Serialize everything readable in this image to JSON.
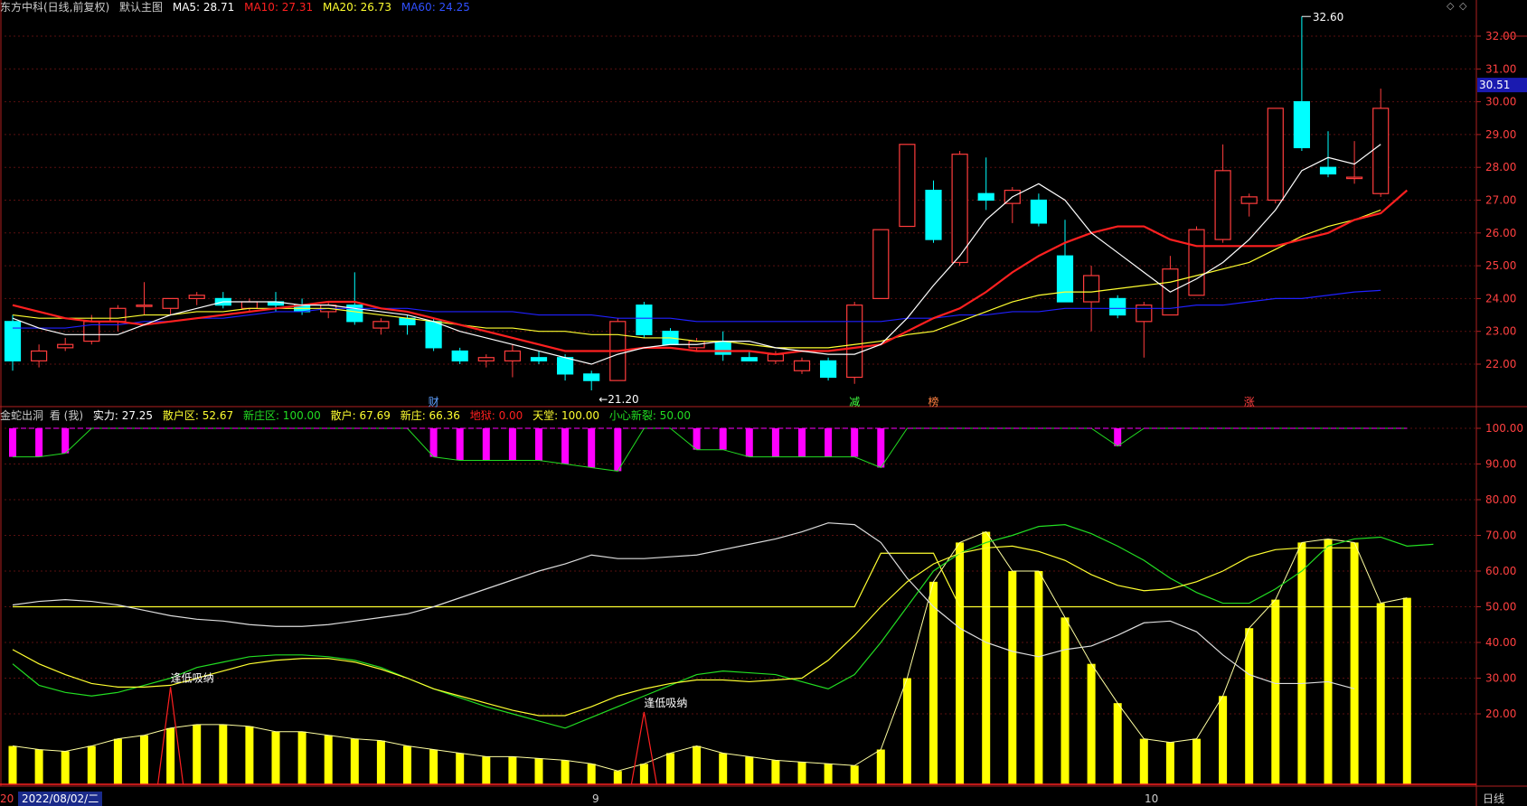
{
  "main_header": {
    "title": "东方中科(日线,前复权)",
    "template": "默认主图",
    "ma5": "MA5: 28.71",
    "ma10": "MA10: 27.31",
    "ma20": "MA20: 26.73",
    "ma60": "MA60: 24.25"
  },
  "ind_header": {
    "name": "金蛇出洞",
    "view": "看 (我)",
    "strength": "实力: 27.25",
    "retail_zone": "散户区: 52.67",
    "new_dealer_zone": "新庄区: 100.00",
    "retail": "散户: 67.69",
    "new_dealer": "新庄: 66.36",
    "ground": "地狱: 0.00",
    "heaven": "天堂: 100.00",
    "careful": "小心新裂: 50.00"
  },
  "price_marker": "30.51",
  "high_label": "32.60",
  "low_label": "←21.20",
  "signal_label": "逢低吸纳",
  "event_labels": [
    "财",
    "减",
    "榜",
    "涨"
  ],
  "bottom_bar": {
    "date": "2022/08/02/二",
    "month1": "9",
    "month2": "10",
    "period": "日线",
    "prefix": "20"
  },
  "colors": {
    "up": "#ff3c3c",
    "down": "#00ffff",
    "ma5": "#ffffff",
    "ma10": "#ff2020",
    "ma20": "#ffff30",
    "ma60": "#2020ff",
    "bar": "#ffff00",
    "magenta": "#ff00ff",
    "green": "#22dd22"
  },
  "chart_data": [
    {
      "type": "candlestick",
      "ylim": [
        21.0,
        33.0
      ],
      "yticks": [
        "22.00",
        "23.00",
        "24.00",
        "25.00",
        "26.00",
        "27.00",
        "28.00",
        "29.00",
        "30.00",
        "31.00",
        "32.00"
      ],
      "ohlc": [
        [
          23.3,
          23.5,
          21.8,
          22.1
        ],
        [
          22.1,
          22.6,
          21.9,
          22.4
        ],
        [
          22.5,
          22.8,
          22.4,
          22.6
        ],
        [
          22.7,
          23.5,
          22.6,
          23.3
        ],
        [
          23.3,
          23.8,
          23.0,
          23.7
        ],
        [
          23.8,
          24.5,
          23.5,
          23.8
        ],
        [
          23.7,
          24.0,
          23.5,
          24.0
        ],
        [
          24.0,
          24.2,
          23.8,
          24.1
        ],
        [
          24.0,
          24.2,
          23.7,
          23.8
        ],
        [
          23.7,
          24.0,
          23.6,
          23.9
        ],
        [
          23.9,
          24.2,
          23.6,
          23.8
        ],
        [
          23.8,
          24.0,
          23.5,
          23.6
        ],
        [
          23.6,
          23.9,
          23.4,
          23.8
        ],
        [
          23.8,
          24.8,
          23.2,
          23.3
        ],
        [
          23.1,
          23.4,
          22.9,
          23.3
        ],
        [
          23.4,
          23.5,
          22.9,
          23.2
        ],
        [
          23.3,
          23.4,
          22.4,
          22.5
        ],
        [
          22.4,
          22.5,
          22.0,
          22.1
        ],
        [
          22.1,
          22.3,
          21.9,
          22.2
        ],
        [
          22.1,
          22.6,
          21.6,
          22.4
        ],
        [
          22.2,
          22.4,
          22.0,
          22.1
        ],
        [
          22.2,
          22.3,
          21.5,
          21.7
        ],
        [
          21.7,
          21.8,
          21.2,
          21.5
        ],
        [
          21.5,
          23.4,
          21.5,
          23.3
        ],
        [
          23.8,
          23.9,
          22.8,
          22.9
        ],
        [
          23.0,
          23.1,
          22.6,
          22.6
        ],
        [
          22.5,
          22.8,
          22.4,
          22.7
        ],
        [
          22.7,
          23.0,
          22.1,
          22.3
        ],
        [
          22.2,
          22.4,
          22.1,
          22.1
        ],
        [
          22.1,
          22.4,
          22.0,
          22.3
        ],
        [
          21.8,
          22.2,
          21.7,
          22.1
        ],
        [
          22.1,
          22.2,
          21.5,
          21.6
        ],
        [
          21.6,
          23.9,
          21.4,
          23.8
        ],
        [
          24.0,
          26.1,
          24.0,
          26.1
        ],
        [
          26.2,
          28.7,
          26.2,
          28.7
        ],
        [
          27.3,
          27.6,
          25.7,
          25.8
        ],
        [
          25.1,
          28.5,
          25.0,
          28.4
        ],
        [
          27.2,
          28.3,
          26.7,
          27.0
        ],
        [
          26.9,
          27.4,
          26.3,
          27.3
        ],
        [
          27.0,
          27.2,
          26.2,
          26.3
        ],
        [
          25.3,
          26.4,
          23.9,
          23.9
        ],
        [
          23.9,
          25.0,
          23.0,
          24.7
        ],
        [
          24.0,
          24.1,
          23.4,
          23.5
        ],
        [
          23.3,
          23.9,
          22.2,
          23.8
        ],
        [
          23.5,
          25.3,
          23.5,
          24.9
        ],
        [
          24.1,
          26.2,
          24.1,
          26.1
        ],
        [
          25.8,
          28.7,
          25.7,
          27.9
        ],
        [
          26.9,
          27.2,
          26.5,
          27.1
        ],
        [
          27.0,
          29.8,
          26.9,
          29.8
        ],
        [
          30.0,
          32.6,
          28.5,
          28.6
        ],
        [
          28.0,
          29.1,
          27.7,
          27.8
        ],
        [
          27.7,
          28.8,
          27.5,
          27.7
        ],
        [
          27.2,
          30.4,
          27.1,
          29.8
        ]
      ],
      "ma5": [
        23.4,
        23.1,
        22.9,
        22.9,
        22.9,
        23.2,
        23.5,
        23.7,
        23.9,
        23.9,
        23.9,
        23.8,
        23.8,
        23.7,
        23.6,
        23.5,
        23.3,
        23.0,
        22.8,
        22.6,
        22.4,
        22.2,
        22.0,
        22.3,
        22.5,
        22.6,
        22.6,
        22.7,
        22.7,
        22.5,
        22.4,
        22.3,
        22.3,
        22.6,
        23.4,
        24.4,
        25.3,
        26.4,
        27.1,
        27.5,
        27.0,
        26.0,
        25.4,
        24.8,
        24.2,
        24.6,
        25.1,
        25.8,
        26.7,
        27.9,
        28.3,
        28.1,
        28.7
      ],
      "ma10": [
        23.8,
        23.6,
        23.4,
        23.3,
        23.3,
        23.2,
        23.3,
        23.4,
        23.5,
        23.6,
        23.7,
        23.8,
        23.9,
        23.9,
        23.7,
        23.6,
        23.4,
        23.2,
        23.0,
        22.8,
        22.6,
        22.4,
        22.4,
        22.4,
        22.5,
        22.5,
        22.4,
        22.4,
        22.4,
        22.3,
        22.4,
        22.4,
        22.5,
        22.6,
        23.0,
        23.4,
        23.7,
        24.2,
        24.8,
        25.3,
        25.7,
        26.0,
        26.2,
        26.2,
        25.8,
        25.6,
        25.6,
        25.6,
        25.6,
        25.8,
        26.0,
        26.4,
        26.6,
        27.3
      ],
      "ma20": [
        23.5,
        23.4,
        23.4,
        23.4,
        23.4,
        23.5,
        23.5,
        23.6,
        23.6,
        23.7,
        23.7,
        23.7,
        23.7,
        23.6,
        23.5,
        23.4,
        23.3,
        23.2,
        23.1,
        23.1,
        23.0,
        23.0,
        22.9,
        22.9,
        22.8,
        22.8,
        22.7,
        22.7,
        22.6,
        22.5,
        22.5,
        22.5,
        22.6,
        22.7,
        22.9,
        23.0,
        23.3,
        23.6,
        23.9,
        24.1,
        24.2,
        24.2,
        24.3,
        24.4,
        24.5,
        24.7,
        24.9,
        25.1,
        25.5,
        25.9,
        26.2,
        26.4,
        26.7
      ],
      "ma60": [
        23.1,
        23.1,
        23.1,
        23.2,
        23.2,
        23.3,
        23.3,
        23.4,
        23.4,
        23.5,
        23.6,
        23.6,
        23.7,
        23.7,
        23.7,
        23.7,
        23.6,
        23.6,
        23.6,
        23.6,
        23.5,
        23.5,
        23.5,
        23.4,
        23.4,
        23.4,
        23.3,
        23.3,
        23.3,
        23.3,
        23.3,
        23.3,
        23.3,
        23.3,
        23.4,
        23.4,
        23.5,
        23.5,
        23.6,
        23.6,
        23.7,
        23.7,
        23.7,
        23.7,
        23.7,
        23.8,
        23.8,
        23.9,
        24.0,
        24.0,
        24.1,
        24.2,
        24.25
      ]
    },
    {
      "type": "indicator",
      "ylim": [
        0,
        104
      ],
      "yticks": [
        "20.00",
        "30.00",
        "40.00",
        "50.00",
        "60.00",
        "70.00",
        "80.00",
        "90.00",
        "100.00"
      ],
      "yellow_bars": [
        11,
        10,
        9.5,
        11,
        13,
        14,
        16,
        17,
        17,
        16.5,
        15,
        15,
        14,
        13,
        12.5,
        11,
        10,
        9,
        8,
        8,
        7.5,
        7,
        6,
        4,
        6,
        9,
        11,
        9,
        8,
        7,
        6.5,
        6,
        5.5,
        10,
        30,
        57,
        68,
        71,
        60,
        60,
        47,
        34,
        23,
        13,
        12,
        13,
        25,
        44,
        52,
        68,
        69,
        68,
        51,
        52.5
      ],
      "magenta_bars": [
        92,
        92,
        93,
        100,
        100,
        100,
        100,
        100,
        100,
        100,
        100,
        100,
        100,
        100,
        100,
        100,
        92,
        91,
        91,
        91,
        91,
        90,
        89,
        88,
        100,
        100,
        94,
        94,
        92,
        92,
        92,
        92,
        92,
        89,
        100,
        100,
        100,
        100,
        100,
        100,
        100,
        100,
        95,
        100,
        100,
        100,
        100,
        100,
        100,
        100,
        100,
        100,
        100,
        100
      ],
      "white_line": [
        50.5,
        51.5,
        52,
        51.5,
        50.5,
        49,
        47.5,
        46.5,
        46,
        45,
        44.5,
        44.5,
        45,
        46,
        47,
        48,
        50,
        52.5,
        55,
        57.5,
        60,
        62,
        64.5,
        63.5,
        63.5,
        64,
        64.5,
        66,
        67.5,
        69,
        71,
        73.5,
        73,
        68,
        58,
        50,
        44,
        40,
        37.5,
        36,
        38,
        39,
        42,
        45.5,
        46,
        43,
        36.5,
        31,
        28.5,
        28.5,
        29,
        27
      ],
      "green_line": [
        34,
        28,
        26,
        25,
        26,
        28,
        30,
        33,
        34.5,
        36,
        36.5,
        36.5,
        36,
        35,
        33,
        30,
        27,
        24.5,
        22,
        20,
        18,
        16,
        19,
        22,
        25,
        28,
        31,
        32,
        31.5,
        31,
        29,
        27,
        31,
        40,
        50,
        60,
        65,
        68,
        70,
        72.5,
        73,
        70.5,
        67,
        63,
        58,
        54,
        51,
        51,
        55,
        60,
        67,
        69,
        69.5,
        67,
        67.5
      ],
      "yellow_line": [
        38,
        34,
        31,
        28.5,
        27.5,
        27.5,
        28,
        30,
        32,
        34,
        35,
        35.5,
        35.5,
        34.5,
        32.5,
        30,
        27,
        25,
        23,
        21,
        19.5,
        19.5,
        22,
        25,
        27,
        28.5,
        29.5,
        29.5,
        29,
        29.5,
        30,
        35,
        42,
        50,
        57,
        62,
        65,
        66.5,
        67,
        65.5,
        63,
        59,
        56,
        54.5,
        55,
        57,
        60,
        64,
        66,
        66.5,
        66.5,
        66.5
      ],
      "flat_line": [
        50,
        50,
        50,
        50,
        50,
        50,
        50,
        50,
        50,
        50,
        50,
        50,
        50,
        50,
        50,
        50,
        50,
        50,
        50,
        50,
        50,
        50,
        50,
        50,
        50,
        50,
        50,
        50,
        50,
        50,
        50,
        50,
        50,
        65,
        65,
        65,
        50,
        50,
        50,
        50,
        50,
        50,
        50,
        50,
        50,
        50,
        50,
        50,
        50,
        50,
        50,
        50,
        50,
        50
      ],
      "red_spikes": [
        [
          6,
          27.5
        ],
        [
          24,
          20.5
        ]
      ]
    }
  ]
}
